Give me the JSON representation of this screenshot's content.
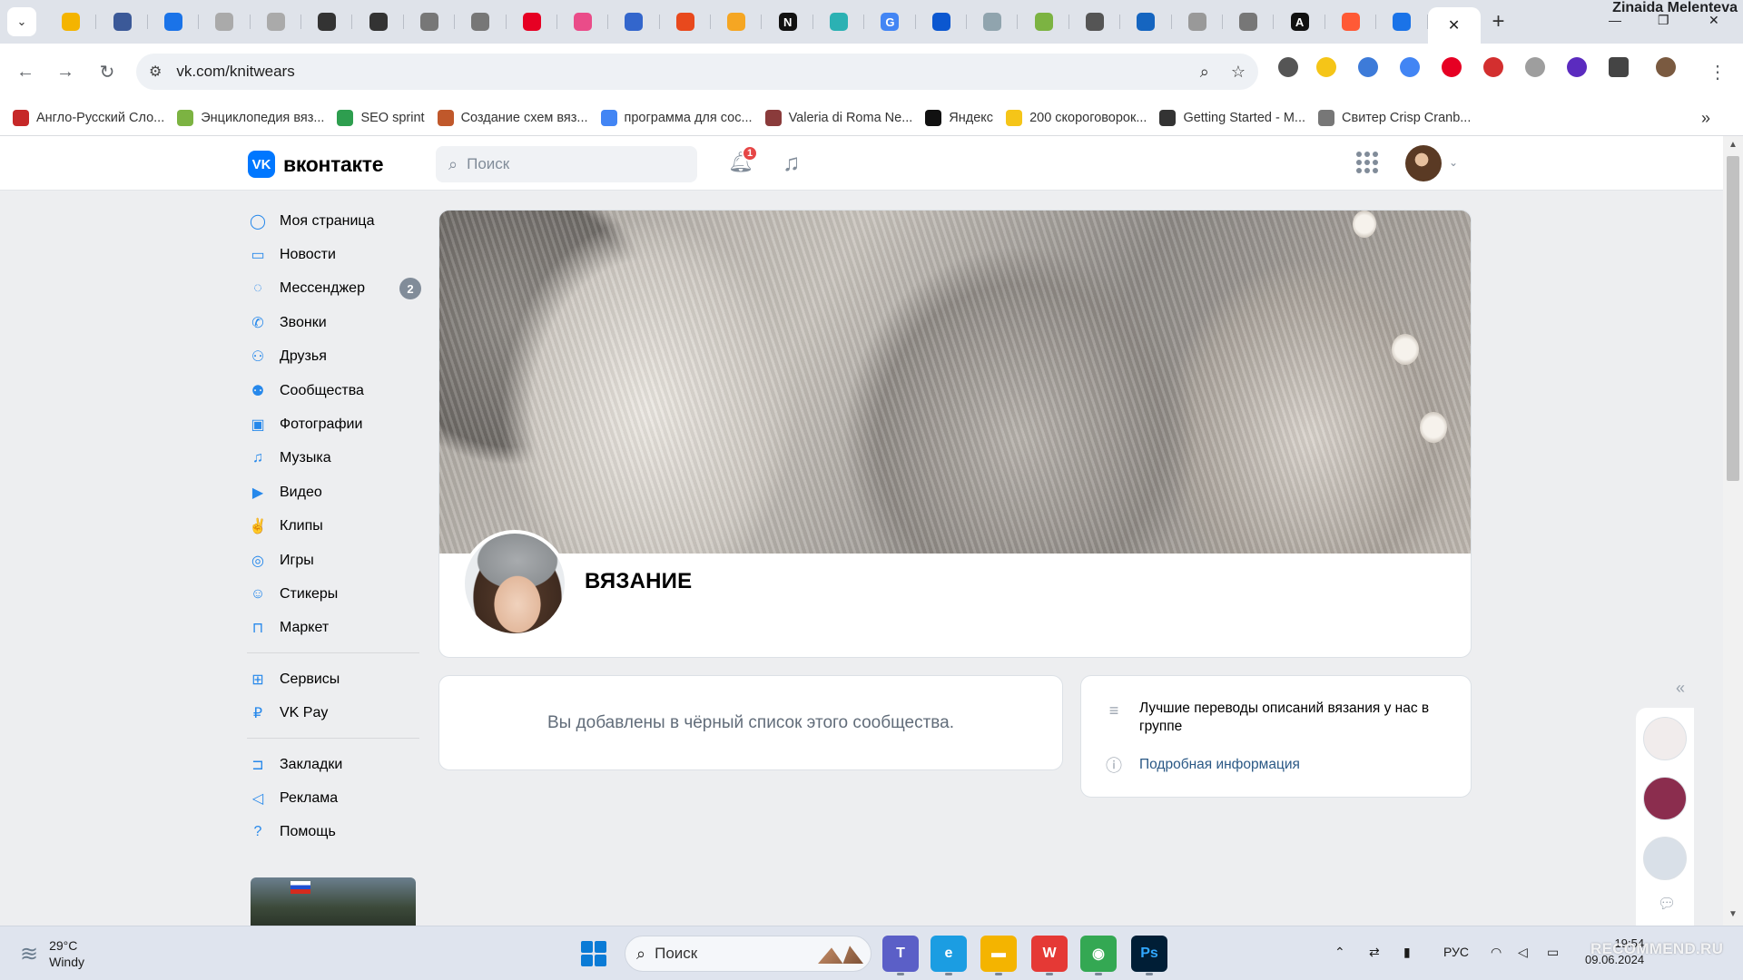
{
  "browser": {
    "profile_name": "Zinaida Melenteva",
    "pinned_tab_colors": [
      "#f4b400",
      "#3b5998",
      "#1a73e8",
      "#aaaaaa",
      "#aaaaaa",
      "#333333",
      "#333333",
      "#777777",
      "#777777",
      "#e60023",
      "#ea4c89",
      "#3366cc",
      "#e8491d",
      "#f5a623",
      "#111111",
      "#2bb1b3",
      "#4285f4",
      "#0b57d0",
      "#90a4ae",
      "#7cb342",
      "#555555",
      "#1565c0",
      "#999999",
      "#777777",
      "#111111",
      "#ff5a36",
      "#1a73e8"
    ],
    "pinned_tab_glyphs": [
      "",
      "",
      "",
      "",
      "",
      "",
      "",
      "",
      "",
      "",
      "",
      "",
      "",
      "",
      "N",
      "",
      "G",
      "",
      "",
      "",
      "",
      "",
      "",
      "",
      "A",
      "",
      ""
    ],
    "active_tab_close": "✕",
    "new_tab": "+",
    "url": "vk.com/knitwears",
    "extension_colors": [
      "#555555",
      "#f5c518",
      "#3d7bd9",
      "#4285f4",
      "#e60023",
      "#d32f2f",
      "#9e9e9e",
      "#5b2bbf",
      "#444444",
      "#7a5a40"
    ],
    "bookmarks": [
      {
        "label": "Англо-Русский Сло...",
        "color": "#c62828"
      },
      {
        "label": "Энциклопедия вяз...",
        "color": "#7cb342"
      },
      {
        "label": "SEO sprint",
        "color": "#2e9e4f"
      },
      {
        "label": "Создание схем вяз...",
        "color": "#c0582b"
      },
      {
        "label": "программа для сос...",
        "color": "#4285f4"
      },
      {
        "label": "Valeria di Roma Ne...",
        "color": "#8a3b3b"
      },
      {
        "label": "Яндекс",
        "color": "#111111"
      },
      {
        "label": "200 скороговорок...",
        "color": "#f5c518"
      },
      {
        "label": "Getting Started - M...",
        "color": "#333333"
      },
      {
        "label": "Свитер Crisp Cranb...",
        "color": "#777777"
      }
    ],
    "bookmarks_more": "»"
  },
  "vk": {
    "logo_text": "вконтакте",
    "logo_mark": "VK",
    "search_placeholder": "Поиск",
    "notifications_count": "1",
    "accent_color": "#0077ff",
    "nav_groups": [
      [
        {
          "label": "Моя страница",
          "icon": "user-circle-icon",
          "glyph": "◯"
        },
        {
          "label": "Новости",
          "icon": "newspaper-icon",
          "glyph": "▭"
        },
        {
          "label": "Мессенджер",
          "icon": "message-icon",
          "glyph": "◌",
          "count": "2"
        },
        {
          "label": "Звонки",
          "icon": "phone-icon",
          "glyph": "✆"
        },
        {
          "label": "Друзья",
          "icon": "friends-icon",
          "glyph": "⚇"
        },
        {
          "label": "Сообщества",
          "icon": "communities-icon",
          "glyph": "⚉"
        },
        {
          "label": "Фотографии",
          "icon": "photos-icon",
          "glyph": "▣"
        },
        {
          "label": "Музыка",
          "icon": "music-icon",
          "glyph": "♫"
        },
        {
          "label": "Видео",
          "icon": "video-icon",
          "glyph": "▶"
        },
        {
          "label": "Клипы",
          "icon": "clips-icon",
          "glyph": "✌"
        },
        {
          "label": "Игры",
          "icon": "games-icon",
          "glyph": "◎"
        },
        {
          "label": "Стикеры",
          "icon": "stickers-icon",
          "glyph": "☺"
        },
        {
          "label": "Маркет",
          "icon": "market-icon",
          "glyph": "⊓"
        }
      ],
      [
        {
          "label": "Сервисы",
          "icon": "services-icon",
          "glyph": "⊞"
        },
        {
          "label": "VK Pay",
          "icon": "vk-pay-icon",
          "glyph": "₽"
        }
      ],
      [
        {
          "label": "Закладки",
          "icon": "bookmark-icon",
          "glyph": "⊐"
        },
        {
          "label": "Реклама",
          "icon": "megaphone-icon",
          "glyph": "◁"
        },
        {
          "label": "Помощь",
          "icon": "help-icon",
          "glyph": "?"
        }
      ]
    ]
  },
  "group": {
    "title": "ВЯЗАНИЕ",
    "blacklist_message": "Вы добавлены в чёрный список этого сообщества.",
    "description": "Лучшие переводы описаний вязания у нас в группе",
    "more_info_link": "Подробная информация"
  },
  "rail": {
    "toggle": "«",
    "avatars": [
      {
        "name": "rail-avatar-sales",
        "color": "#f1ecec"
      },
      {
        "name": "rail-avatar-love-handmade",
        "color": "#8b2d4e"
      },
      {
        "name": "rail-avatar-person",
        "color": "#d9e0e8"
      }
    ]
  },
  "taskbar": {
    "temperature": "29°C",
    "weather": "Windy",
    "search_placeholder": "Поиск",
    "language": "РУС",
    "time": "19:54",
    "date": "09.06.2024",
    "apps": [
      {
        "name": "teams-app",
        "glyph": "T",
        "color": "#5b5fc7"
      },
      {
        "name": "edge-app",
        "glyph": "e",
        "color": "#1b9de2"
      },
      {
        "name": "explorer-app",
        "glyph": "▬",
        "color": "#f4b400"
      },
      {
        "name": "wps-app",
        "glyph": "W",
        "color": "#e53935"
      },
      {
        "name": "chrome-app",
        "glyph": "◉",
        "color": "#34a853"
      },
      {
        "name": "photoshop-app",
        "glyph": "Ps",
        "color": "#001e36"
      }
    ]
  },
  "watermark": "RECOMMEND.RU"
}
